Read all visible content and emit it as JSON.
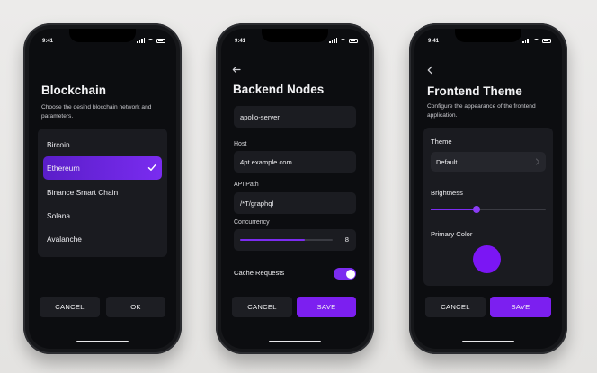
{
  "status": {
    "time": "9:41"
  },
  "screens": [
    {
      "title": "Blockchain",
      "subtitle": "Choose the desind blocchain network and parameters.",
      "chains": [
        "Bircoin",
        "Ethereurn",
        "Binance Smart Chain",
        "Solana",
        "Avalanche"
      ],
      "selected": "Ethereurn",
      "cancel": "CANCEL",
      "ok": "OK"
    },
    {
      "title": "Backend Nodes",
      "name_value": "apollo-server",
      "host_label": "Host",
      "host_value": "4pt.example.com",
      "api_label": "API Path",
      "api_value": "/*T/graphql",
      "concurrency_label": "Concurrency",
      "concurrency_value": "8",
      "concurrency_level": 0.7,
      "cache_label": "Cache Requests",
      "cache_on": true,
      "cancel": "CANCEL",
      "save": "SAVE"
    },
    {
      "title": "Frontend Theme",
      "subtitle": "Configure the appearance of the frontend application.",
      "theme_label": "Theme",
      "theme_value": "Default",
      "brightness_label": "Brightness",
      "brightness_level": 0.4,
      "primary_label": "Primary Color",
      "primary_color": "#7b16f4",
      "cancel": "CANCEL",
      "save": "SAVE"
    }
  ],
  "colors": {
    "accent": "#7c1ff0",
    "background": "#0c0d10",
    "card": "#1a1b20"
  },
  "icons": [
    "back-arrow-icon",
    "check-icon",
    "chevron-right-icon",
    "signal-icon",
    "wifi-icon",
    "battery-icon"
  ]
}
